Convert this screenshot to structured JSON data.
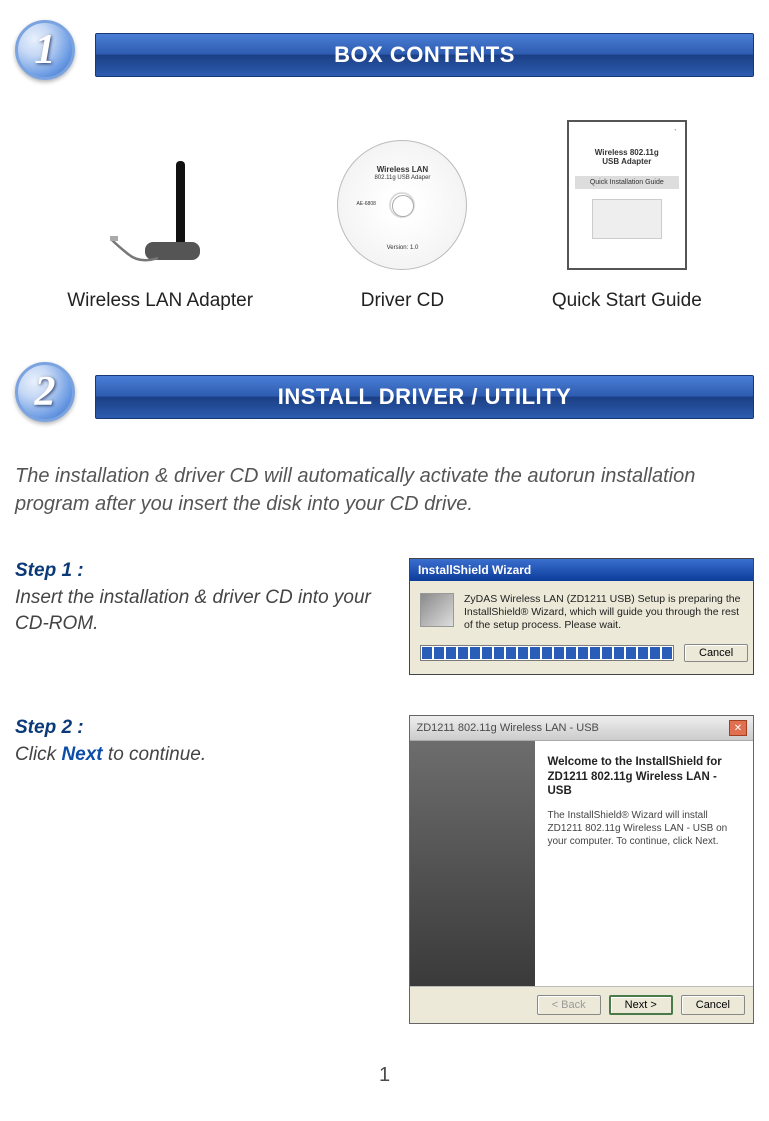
{
  "section1": {
    "number": "1",
    "title": "BOX CONTENTS",
    "items": [
      {
        "label": "Wireless LAN Adapter"
      },
      {
        "label": "Driver CD",
        "cd_title": "Wireless LAN",
        "cd_sub": "802.11g USB Adaper",
        "cd_left": "AE-6808",
        "cd_ver": "Version: 1.0"
      },
      {
        "label": "Quick Start Guide",
        "man_title": "Wireless 802.11g",
        "man_sub": "USB Adapter",
        "man_bar": "Quick Installation Guide"
      }
    ]
  },
  "section2": {
    "number": "2",
    "title": "INSTALL DRIVER / UTILITY",
    "intro": "The installation & driver CD   will automatically activate the autorun installation program after you insert the disk into your CD drive.",
    "step1": {
      "label": "Step 1 :",
      "text": "Insert the installation & driver CD into your CD-ROM."
    },
    "step2": {
      "label": "Step 2 :",
      "text_before": "Click ",
      "next": "Next",
      "text_after": " to continue."
    }
  },
  "dialog1": {
    "title": "InstallShield Wizard",
    "body": "ZyDAS Wireless LAN (ZD1211 USB) Setup is preparing the InstallShield® Wizard, which will guide you through the rest of the setup process. Please wait.",
    "cancel": "Cancel"
  },
  "dialog2": {
    "title": "ZD1211 802.11g Wireless LAN - USB",
    "heading": "Welcome to the InstallShield for ZD1211 802.11g Wireless LAN - USB",
    "body": "The InstallShield® Wizard will install ZD1211 802.11g Wireless LAN - USB on your computer. To continue, click Next.",
    "back": "< Back",
    "next": "Next >",
    "cancel": "Cancel"
  },
  "page": "1"
}
